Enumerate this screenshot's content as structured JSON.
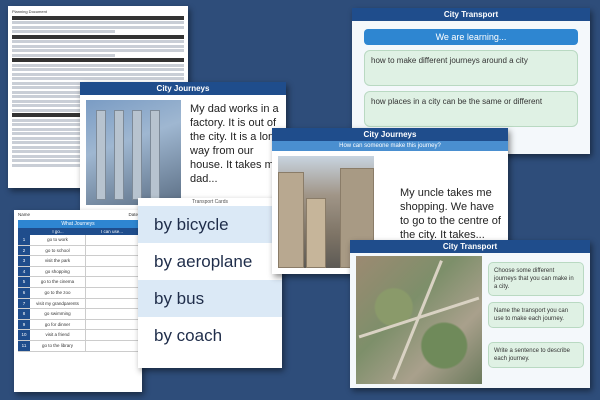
{
  "plan": {
    "title": "Planning Document"
  },
  "transport1": {
    "header": "City Transport",
    "learning_banner": "We are learning...",
    "objectives": [
      "how to make different journeys around a city",
      "how places in a city can be the same or different"
    ]
  },
  "journeys1": {
    "header": "City Journeys",
    "story": "My dad works in a factory. It is out of the city. It is a long way from our house. It takes my dad..."
  },
  "worksheet": {
    "name_label": "Name",
    "date_label": "Date",
    "title": "What Journeys",
    "col_go": "I go...",
    "col_use": "I can use...",
    "rows": [
      {
        "num": "1",
        "text": "go to work"
      },
      {
        "num": "2",
        "text": "go to school"
      },
      {
        "num": "3",
        "text": "visit the park"
      },
      {
        "num": "4",
        "text": "go shopping"
      },
      {
        "num": "5",
        "text": "go to the cinema"
      },
      {
        "num": "6",
        "text": "go to the zoo"
      },
      {
        "num": "7",
        "text": "visit my grandparents"
      },
      {
        "num": "8",
        "text": "go swimming"
      },
      {
        "num": "9",
        "text": "go for dinner"
      },
      {
        "num": "10",
        "text": "visit a friend"
      },
      {
        "num": "11",
        "text": "go to the library"
      }
    ]
  },
  "cards": {
    "title": "Transport Cards",
    "items": [
      "by bicycle",
      "by aeroplane",
      "by bus",
      "by coach"
    ]
  },
  "journeys2": {
    "header": "City Journeys",
    "question": "How can someone make this journey?",
    "story": "My uncle takes me shopping. We have to go to the centre of the city. It takes..."
  },
  "transport2": {
    "header": "City Transport",
    "tasks": [
      "Choose some different journeys that you can make in a city.",
      "Name the transport you can use to make each journey.",
      "Write a sentence to describe each journey."
    ]
  },
  "colors": {
    "background": "#2e4d7a",
    "header_blue": "#1f4d8c",
    "accent_blue": "#2e86d1",
    "green_box": "#dff1e4"
  }
}
